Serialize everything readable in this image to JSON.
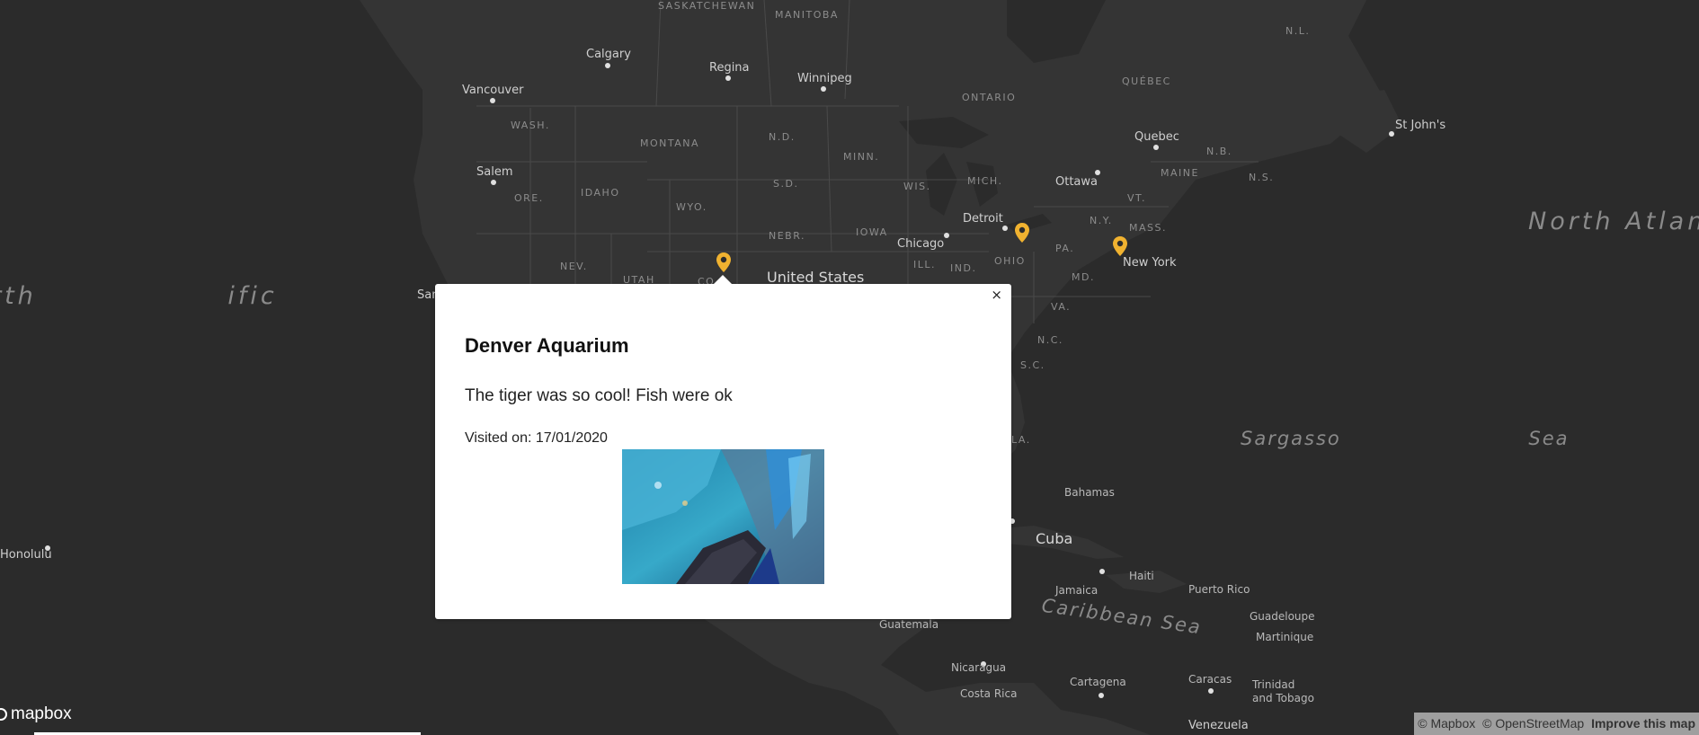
{
  "map": {
    "oceans": [
      {
        "id": "north-atlantic",
        "text": "North Atlantic Ocean"
      },
      {
        "id": "north-pacific",
        "text": "rth ific an"
      },
      {
        "id": "sargasso",
        "text": "Sargasso Sea"
      },
      {
        "id": "caribbean",
        "text": "Caribbean Sea"
      }
    ],
    "labels": {
      "saskatchewan": "SASKATCHEWAN",
      "manitoba": "MANITOBA",
      "nl": "N.L.",
      "quebec_prov": "QUÉBEC",
      "ontario": "ONTARIO",
      "wash": "WASH.",
      "montana": "MONTANA",
      "nd": "N.D.",
      "minn": "MINN.",
      "ore": "ORE.",
      "idaho": "IDAHO",
      "sd": "S.D.",
      "wyo": "WYO.",
      "nebr": "NEBR.",
      "iowa": "IOWA",
      "wis": "WIS.",
      "mich": "MICH.",
      "ill": "ILL.",
      "ind": "IND.",
      "ohio": "OHIO",
      "pa": "PA.",
      "ny": "N.Y.",
      "vt": "VT.",
      "mass": "MASS.",
      "maine": "MAINE",
      "nb": "N.B.",
      "ns": "N.S.",
      "nev": "NEV.",
      "utah": "UTAH",
      "co": "CO",
      "md": "MD.",
      "va": "VA.",
      "nc": "N.C.",
      "sc": "S.C.",
      "la": "LA.",
      "calgary": "Calgary",
      "regina": "Regina",
      "winnipeg": "Winnipeg",
      "vancouver": "Vancouver",
      "salem": "Salem",
      "quebec_city": "Quebec",
      "st_johns": "St John's",
      "ottawa": "Ottawa",
      "detroit": "Detroit",
      "chicago": "Chicago",
      "new_york": "New York",
      "san": "San",
      "honolulu": "Honolulu",
      "bahamas": "Bahamas",
      "cuba": "Cuba",
      "haiti": "Haiti",
      "jamaica": "Jamaica",
      "puerto_rico": "Puerto Rico",
      "guadeloupe": "Guadeloupe",
      "martinique": "Martinique",
      "guatemala": "Guatemala",
      "nicaragua": "Nicaragua",
      "costa_rica": "Costa Rica",
      "cartagena": "Cartagena",
      "caracas": "Caracas",
      "trinidad": "Trinidad",
      "tobago": "and Tobago",
      "venezuela": "Venezuela",
      "united_states": "United States"
    },
    "markers": [
      "denver-aquarium",
      "marker-ohio",
      "marker-new-york"
    ],
    "marker_color": "#f0b230"
  },
  "popup": {
    "title": "Denver Aquarium",
    "description": "The tiger was so cool! Fish were ok",
    "visited": "Visited on: 17/01/2020",
    "close": "×"
  },
  "footer": {
    "logo": "mapbox",
    "attribution_mapbox": "© Mapbox",
    "attribution_osm": "© OpenStreetMap",
    "improve": "Improve this map"
  }
}
